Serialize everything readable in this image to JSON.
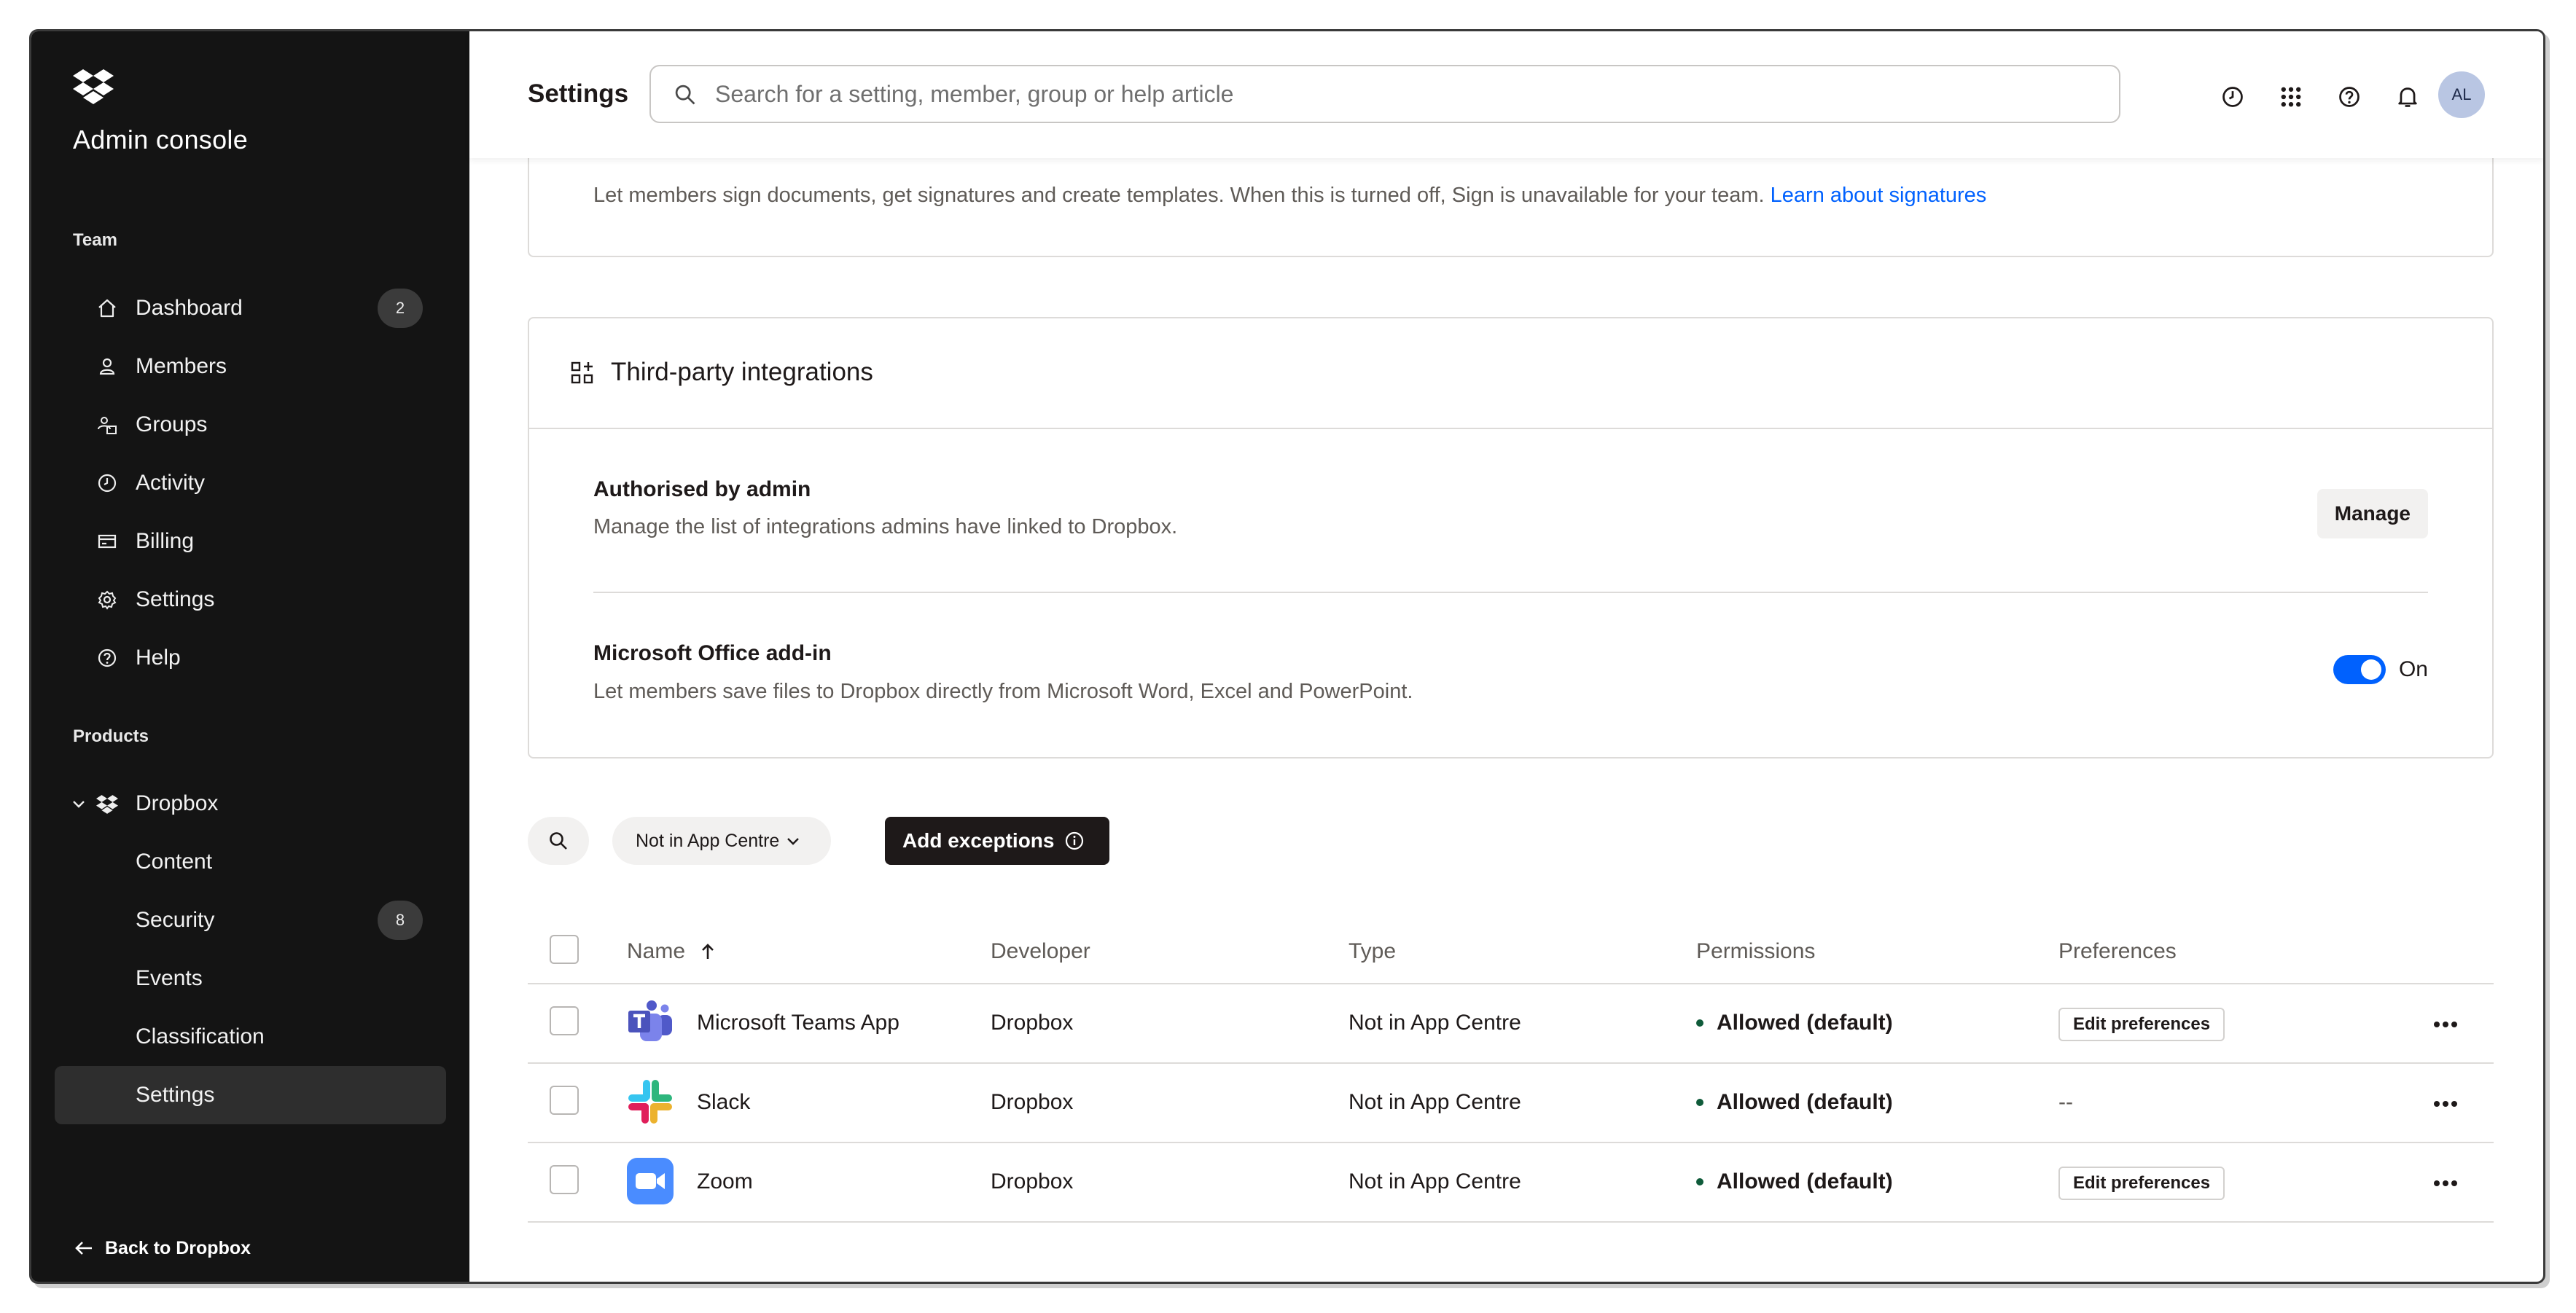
{
  "sidebar": {
    "title": "Admin console",
    "team_label": "Team",
    "team_items": [
      {
        "label": "Dashboard",
        "icon": "home-icon",
        "badge": "2"
      },
      {
        "label": "Members",
        "icon": "person-icon"
      },
      {
        "label": "Groups",
        "icon": "groups-icon"
      },
      {
        "label": "Activity",
        "icon": "clock-icon"
      },
      {
        "label": "Billing",
        "icon": "billing-icon"
      },
      {
        "label": "Settings",
        "icon": "gear-icon"
      },
      {
        "label": "Help",
        "icon": "help-icon"
      }
    ],
    "products_label": "Products",
    "product": {
      "label": "Dropbox",
      "icon": "dropbox-icon"
    },
    "product_items": [
      {
        "label": "Content"
      },
      {
        "label": "Security",
        "badge": "8"
      },
      {
        "label": "Events"
      },
      {
        "label": "Classification"
      },
      {
        "label": "Settings",
        "active": true
      }
    ],
    "back_label": "Back to Dropbox"
  },
  "header": {
    "title": "Settings",
    "search_placeholder": "Search for a setting, member, group or help article",
    "avatar_initials": "AL"
  },
  "sign_card": {
    "description": "Let members sign documents, get signatures and create templates. When this is turned off, Sign is unavailable for your team.",
    "link": "Learn about signatures"
  },
  "integrations": {
    "title": "Third-party integrations",
    "authorised": {
      "title": "Authorised by admin",
      "description": "Manage the list of integrations admins have linked to Dropbox.",
      "button": "Manage"
    },
    "office": {
      "title": "Microsoft Office add-in",
      "description": "Let members save files to Dropbox directly from Microsoft Word, Excel and PowerPoint.",
      "toggle_label": "On",
      "toggle_on": true
    }
  },
  "filters": {
    "filter_label": "Not in App Centre",
    "add_button": "Add exceptions"
  },
  "table": {
    "columns": {
      "name": "Name",
      "developer": "Developer",
      "type": "Type",
      "permissions": "Permissions",
      "preferences": "Preferences"
    },
    "rows": [
      {
        "name": "Microsoft Teams App",
        "icon": "teams-icon",
        "developer": "Dropbox",
        "type": "Not in App Centre",
        "permission": "Allowed (default)",
        "preference": "Edit preferences"
      },
      {
        "name": "Slack",
        "icon": "slack-icon",
        "developer": "Dropbox",
        "type": "Not in App Centre",
        "permission": "Allowed (default)",
        "preference": "--"
      },
      {
        "name": "Zoom",
        "icon": "zoom-icon",
        "developer": "Dropbox",
        "type": "Not in App Centre",
        "permission": "Allowed (default)",
        "preference": "Edit preferences"
      }
    ]
  },
  "colors": {
    "accent": "#0061fe",
    "sidebar_bg": "#141414",
    "primary_button": "#1e1919"
  }
}
